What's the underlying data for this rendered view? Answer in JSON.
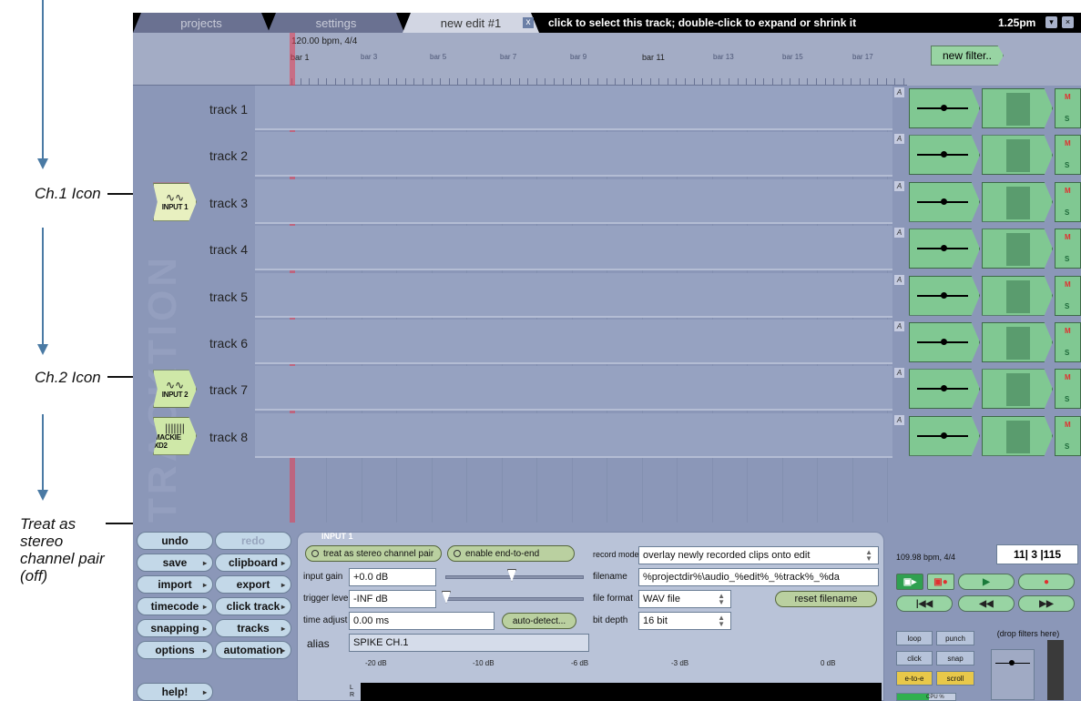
{
  "tabs": [
    {
      "label": "projects"
    },
    {
      "label": "settings"
    },
    {
      "label": "new edit #1",
      "close": "x"
    }
  ],
  "topbar": {
    "hint": "click to select this track; double-click to expand or shrink it",
    "clock": "1.25pm",
    "buttons": [
      "▾",
      "×"
    ]
  },
  "ruler": {
    "tempo": "120.00 bpm, 4/4",
    "bars": [
      "bar 1",
      "bar 3",
      "bar 5",
      "bar 7",
      "bar 9",
      "bar 11",
      "bar 13",
      "bar 15",
      "bar 17"
    ],
    "new_filter": "new filter.."
  },
  "watermark": "TRACKTION",
  "tracks": [
    {
      "name": "track 1"
    },
    {
      "name": "track 2"
    },
    {
      "name": "track 3",
      "icon": {
        "wave": "∿∿",
        "label": "INPUT 1"
      }
    },
    {
      "name": "track 4"
    },
    {
      "name": "track 5"
    },
    {
      "name": "track 6"
    },
    {
      "name": "track 7",
      "icon": {
        "wave": "∿∿",
        "label": "INPUT 2"
      }
    },
    {
      "name": "track 8",
      "icon": {
        "wave": "|||||||",
        "label": "MACKIE XD2"
      }
    }
  ],
  "track_controls": {
    "auto": "A",
    "mute": "M",
    "solo": "S"
  },
  "left_buttons": [
    {
      "label": "undo",
      "arrow": ""
    },
    {
      "label": "redo",
      "arrow": ""
    },
    {
      "label": "save",
      "arrow": "▸"
    },
    {
      "label": "clipboard",
      "arrow": "▸"
    },
    {
      "label": "import",
      "arrow": "▸"
    },
    {
      "label": "export",
      "arrow": "▸"
    },
    {
      "label": "timecode",
      "arrow": "▸"
    },
    {
      "label": "click track",
      "arrow": "▸"
    },
    {
      "label": "snapping",
      "arrow": "▸"
    },
    {
      "label": "tracks",
      "arrow": "▸"
    },
    {
      "label": "options",
      "arrow": "▸"
    },
    {
      "label": "automation",
      "arrow": "▸"
    },
    {
      "label": "help!",
      "arrow": "▸"
    }
  ],
  "input_panel": {
    "title": "INPUT 1",
    "stereo_pair": "treat as stereo channel pair",
    "end_to_end": "enable end-to-end",
    "input_gain_label": "input gain",
    "input_gain": "+0.0 dB",
    "trigger_label": "trigger level",
    "trigger": "-INF dB",
    "time_adjust_label": "time adjust",
    "time_adjust": "0.00 ms",
    "auto_detect": "auto-detect...",
    "alias_label": "alias",
    "alias": "SPIKE CH.1",
    "record_mode_label": "record mode",
    "record_mode": "overlay newly recorded clips onto edit",
    "filename_label": "filename",
    "filename": "%projectdir%\\audio_%edit%_%track%_%da",
    "file_format_label": "file format",
    "file_format": "WAV file",
    "reset_filename": "reset filename",
    "bit_depth_label": "bit depth",
    "bit_depth": "16 bit",
    "meter_scale": [
      "-20 dB",
      "-10 dB",
      "-6 dB",
      "-3 dB",
      "0 dB"
    ],
    "meter_channels": [
      "L",
      "R"
    ]
  },
  "transport": {
    "tempo": "109.98 bpm, 4/4",
    "position": "11| 3 |115",
    "row1": [
      "▣▸",
      "▣●",
      "▶",
      "●"
    ],
    "row2": [
      "|◀◀",
      "◀◀",
      "▶▶"
    ],
    "toggles": [
      "loop",
      "punch",
      "click",
      "snap",
      "e-to-e",
      "scroll"
    ],
    "cpu_label": "CPU %",
    "cpu_level": 0.55,
    "drop_filters": "(drop filters here)"
  },
  "annotations": {
    "ch1": "Ch.1 Icon",
    "ch2": "Ch.2 Icon",
    "stereo": "Treat as stereo channel pair (off)"
  },
  "colors": {
    "accent_green": "#98d4a3",
    "selection_red": "#e83030",
    "arrow_blue": "#4a7aa4"
  }
}
